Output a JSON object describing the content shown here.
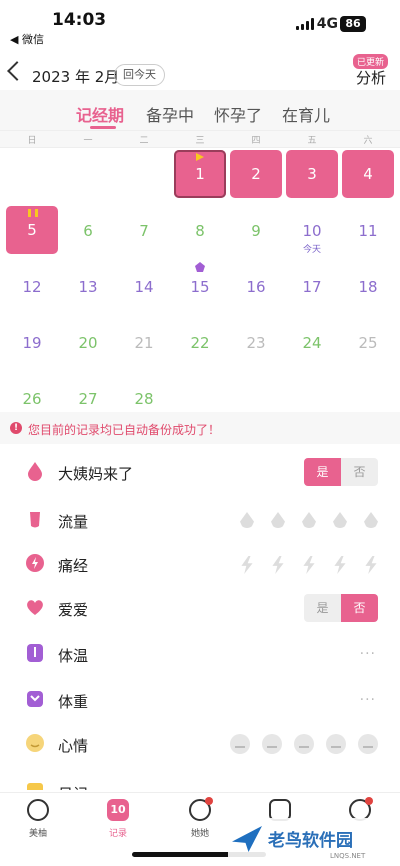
{
  "status_bar": {
    "time": "14:03",
    "back_label": "◀ 微信",
    "network": "4G",
    "battery": "86"
  },
  "header": {
    "month": "2023 年 2月",
    "today_button": "回今天",
    "analysis": "分析",
    "update_badge": "已更新"
  },
  "mode_tabs": [
    {
      "label": "记经期",
      "active": true
    },
    {
      "label": "备孕中",
      "active": false
    },
    {
      "label": "怀孕了",
      "active": false
    },
    {
      "label": "在育儿",
      "active": false
    }
  ],
  "weekdays": [
    "日",
    "一",
    "二",
    "三",
    "四",
    "五",
    "六"
  ],
  "calendar": {
    "days": [
      {
        "num": "1",
        "type": "period",
        "marker": "start"
      },
      {
        "num": "2",
        "type": "period"
      },
      {
        "num": "3",
        "type": "period"
      },
      {
        "num": "4",
        "type": "period"
      },
      {
        "num": "5",
        "type": "period",
        "marker": "pause"
      },
      {
        "num": "6",
        "type": "green"
      },
      {
        "num": "7",
        "type": "green"
      },
      {
        "num": "8",
        "type": "green"
      },
      {
        "num": "9",
        "type": "green"
      },
      {
        "num": "10",
        "type": "purple",
        "sub": "今天"
      },
      {
        "num": "11",
        "type": "purple"
      },
      {
        "num": "12",
        "type": "purple"
      },
      {
        "num": "13",
        "type": "purple"
      },
      {
        "num": "14",
        "type": "purple"
      },
      {
        "num": "15",
        "type": "purple",
        "marker": "ovulation"
      },
      {
        "num": "16",
        "type": "purple"
      },
      {
        "num": "17",
        "type": "purple"
      },
      {
        "num": "18",
        "type": "purple"
      },
      {
        "num": "19",
        "type": "purple"
      },
      {
        "num": "20",
        "type": "green"
      },
      {
        "num": "21",
        "type": "grey"
      },
      {
        "num": "22",
        "type": "green"
      },
      {
        "num": "23",
        "type": "grey"
      },
      {
        "num": "24",
        "type": "green"
      },
      {
        "num": "25",
        "type": "grey"
      },
      {
        "num": "26",
        "type": "green"
      },
      {
        "num": "27",
        "type": "green"
      },
      {
        "num": "28",
        "type": "green"
      }
    ]
  },
  "notice": {
    "text": "您目前的记录均已自动备份成功了！"
  },
  "records": {
    "period": {
      "label": "大姨妈来了",
      "yes": "是",
      "no": "否",
      "selected": "yes"
    },
    "flow": {
      "label": "流量"
    },
    "pain": {
      "label": "痛经"
    },
    "love": {
      "label": "爱爱",
      "yes": "是",
      "no": "否",
      "selected": "no"
    },
    "temperature": {
      "label": "体温",
      "more": "···"
    },
    "weight": {
      "label": "体重",
      "more": "···"
    },
    "mood": {
      "label": "心情"
    },
    "diary": {
      "label": "日记"
    }
  },
  "tabbar": [
    {
      "label": "美柚",
      "active": false
    },
    {
      "label": "记录",
      "active": true,
      "icon_text": "10"
    },
    {
      "label": "她她",
      "active": false
    },
    {
      "label": "",
      "active": false
    },
    {
      "label": "",
      "active": false
    }
  ],
  "watermark": {
    "text": "老鸟软件园",
    "sub": "LNQS.NET"
  },
  "colors": {
    "accent": "#e8628f",
    "green": "#7cc36a",
    "purple": "#8c6dcd",
    "notice": "#e04a6c"
  }
}
